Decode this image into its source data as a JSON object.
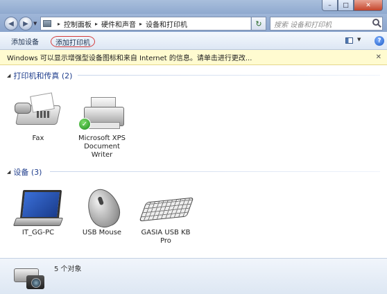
{
  "window": {
    "minimize_glyph": "–",
    "maximize_glyph": "□",
    "close_glyph": "✕"
  },
  "nav": {
    "back_glyph": "◀",
    "forward_glyph": "▶",
    "dropdown_glyph": "▼"
  },
  "address": {
    "separator": "▸",
    "crumbs": [
      "控制面板",
      "硬件和声音",
      "设备和打印机"
    ],
    "dropdown_glyph": "▼",
    "refresh_glyph": "↻"
  },
  "search": {
    "placeholder": "搜索 设备和打印机"
  },
  "toolbar": {
    "add_device": "添加设备",
    "add_printer": "添加打印机",
    "view_dropdown_glyph": "▼",
    "help_glyph": "?"
  },
  "infobar": {
    "text": "Windows 可以显示增强型设备图标和来自 Internet 的信息。请单击进行更改...",
    "close_glyph": "✕"
  },
  "groups": [
    {
      "title": "打印机和传真 (2)",
      "arrow": "◢",
      "devices": [
        {
          "label": "Fax",
          "icon": "fax-icon"
        },
        {
          "label": "Microsoft XPS Document Writer",
          "icon": "printer-icon",
          "default_check": "✓"
        }
      ]
    },
    {
      "title": "设备 (3)",
      "arrow": "◢",
      "devices": [
        {
          "label": "IT_GG-PC",
          "icon": "laptop-icon"
        },
        {
          "label": "USB Mouse",
          "icon": "mouse-icon"
        },
        {
          "label": "GASIA USB KB Pro",
          "icon": "keyboard-icon"
        }
      ]
    }
  ],
  "details": {
    "count_text": "5 个对象"
  }
}
